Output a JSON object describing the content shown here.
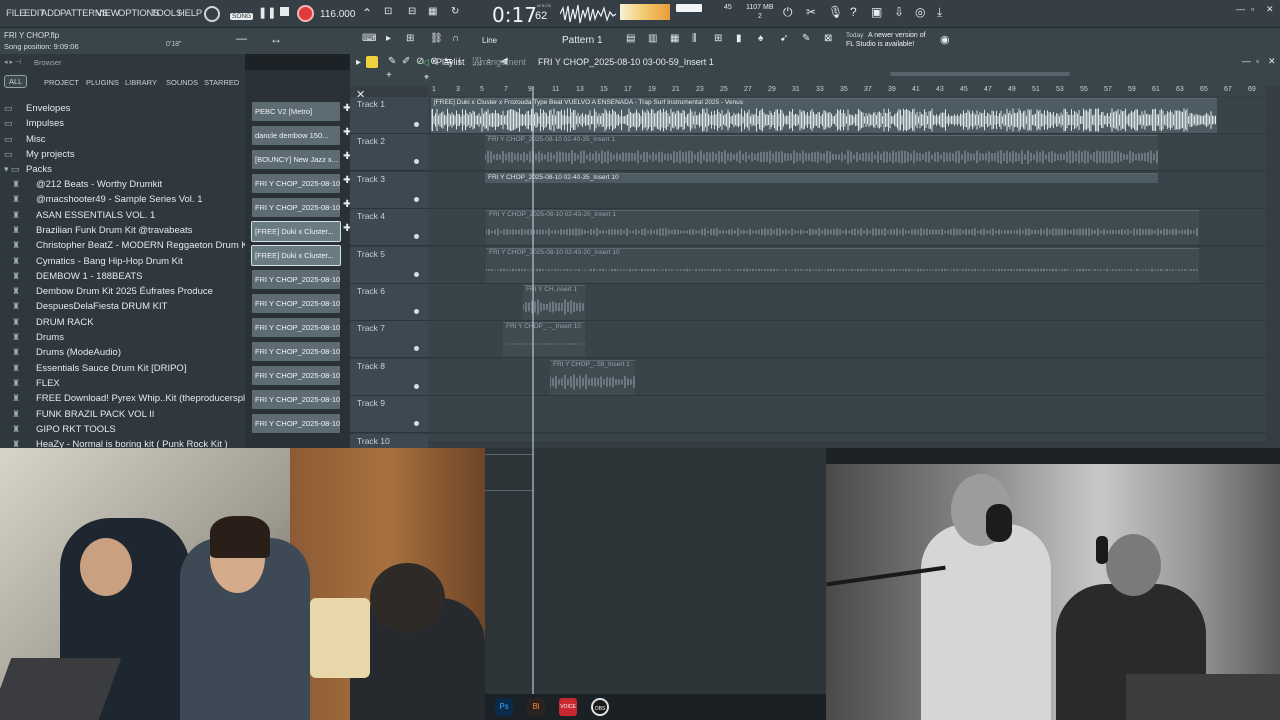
{
  "menu": [
    "FILE",
    "EDIT",
    "ADD",
    "PATTERNS",
    "VIEW",
    "OPTIONS",
    "TOOLS",
    "HELP"
  ],
  "transport": {
    "song_badge": "SONG",
    "tempo": "116.000",
    "time": "0:17",
    "time_sub": "62",
    "time_unit": "M:S:CS",
    "cpu": "45",
    "memory": "1107 MB",
    "poly": "2"
  },
  "hint": {
    "project": "FRI Y CHOP.flp",
    "position": "Song position: 9:09:06",
    "time_small": "0'18\""
  },
  "update": {
    "today": "Today",
    "msg1": "A newer version of",
    "msg2": "FL Studio is available!"
  },
  "toolbar2": {
    "snap": "Line",
    "pattern": "Pattern 1"
  },
  "browser": {
    "title": "Browser",
    "tabs": [
      "ALL",
      "PROJECT",
      "PLUGINS",
      "LIBRARY",
      "SOUNDS",
      "STARRED"
    ],
    "folders": [
      "Envelopes",
      "Impulses",
      "Misc",
      "My projects",
      "Packs"
    ],
    "packs": [
      "@212 Beats - Worthy Drumkit",
      "@macshooter49 - Sample Series Vol. 1",
      "ASAN ESSENTIALS VOL. 1",
      "Brazilian Funk Drum Kit @travabeats",
      "Christopher BeatZ - MODERN Reggaeton Drum Kit (FREE)",
      "Cymatics - Bang Hip-Hop Drum Kit",
      "DEMBOW 1 - 188BEATS",
      "Dembow Drum Kit 2025 Éufrates Produce",
      "DespuesDelaFiesta DRUM KIT",
      "DRUM RACK",
      "Drums",
      "Drums (ModeAudio)",
      "Essentials Sauce Drum Kit [DRIPO]",
      "FLEX",
      "FREE Download! Pyrex Whip..Kit (theproducersplug.com)",
      "FUNK BRAZIL PACK VOL II",
      "GIPO RKT TOOLS",
      "HeaZy - Normal is boring kit ( Punk Rock Kit )"
    ]
  },
  "channels": [
    "PEBC V2 [Metro]",
    "dancle dembow 150...",
    "[BOUNCY] New Jazz x...",
    "FRI Y CHOP_2025-08-10...",
    "FRI Y CHOP_2025-08-10...",
    "[FREE] Duki x Cluster...",
    "[FREE] Duki x Cluster...",
    "FRI Y CHOP_2025-08-10...",
    "FRI Y CHOP_2025-08-10...",
    "FRI Y CHOP_2025-08-10...",
    "FRI Y CHOP_2025-08-10...",
    "FRI Y CHOP_2025-08-10...",
    "FRI Y CHOP_2025-08-10...",
    "FRI Y CHOP_2025-08-10..."
  ],
  "playlist": {
    "label": "Playlist",
    "sub": "Arrangement",
    "clip_name": "FRI Y CHOP_2025-08-10 03-00-59_Insert 1",
    "ruler": [
      "1",
      "3",
      "5",
      "7",
      "9",
      "11",
      "13",
      "15",
      "17",
      "19",
      "21",
      "23",
      "25",
      "27",
      "29",
      "31",
      "33",
      "35",
      "37",
      "39",
      "41",
      "43",
      "45",
      "47",
      "49",
      "51",
      "53",
      "55",
      "57",
      "59",
      "61",
      "63",
      "65",
      "67",
      "69"
    ],
    "tracks": [
      "Track 1",
      "Track 2",
      "Track 3",
      "Track 4",
      "Track 5",
      "Track 6",
      "Track 7",
      "Track 8",
      "Track 9",
      "Track 10"
    ],
    "clips": [
      "[FREE] Duki x Cluster x Frozouda Type Beat VUELVO A ENSENADA - Trap Surf Instrumental 2025 - Venus",
      "FRI Y CHOP_2025-08-10 02-40-35_Insert 1",
      "FRI Y CHOP_2025-08-10 02-40-35_Insert 10",
      "FRI Y CHOP_2025-08-10 02-43-20_Insert 1",
      "FRI Y CHOP_2025-08-10 02-43-20_Insert 10",
      "FRI Y CH..nsert 1",
      "FRI Y CHOP_..._Insert 10",
      "FRI Y CHOP_..59_Insert 1"
    ]
  },
  "taskbar": [
    "Ps",
    "Bl",
    "VOICE",
    "OBS"
  ]
}
